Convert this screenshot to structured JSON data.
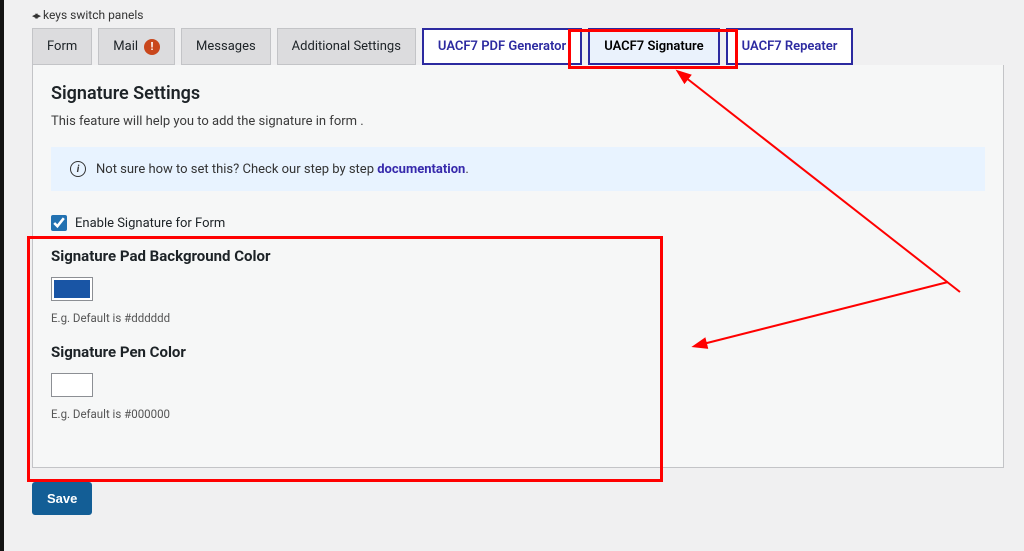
{
  "panelHint": {
    "text": "keys switch panels"
  },
  "tabs": [
    {
      "label": "Form",
      "name": "tab-form"
    },
    {
      "label": "Mail",
      "name": "tab-mail",
      "warn": true
    },
    {
      "label": "Messages",
      "name": "tab-messages"
    },
    {
      "label": "Additional Settings",
      "name": "tab-additional-settings"
    },
    {
      "label": "UACF7 PDF Generator",
      "name": "tab-uacf7-pdf-generator",
      "special": true
    },
    {
      "label": "UACF7 Signature",
      "name": "tab-uacf7-signature",
      "special": true,
      "active": true
    },
    {
      "label": "UACF7 Repeater",
      "name": "tab-uacf7-repeater",
      "special": true
    }
  ],
  "panel": {
    "title": "Signature Settings",
    "description": "This feature will help you to add the signature in form ."
  },
  "notice": {
    "prefix": "Not sure how to set this? Check our step by step ",
    "linkText": "documentation",
    "suffix": "."
  },
  "enable": {
    "label": "Enable Signature for Form",
    "checked": true
  },
  "bgColor": {
    "title": "Signature Pad Background Color",
    "value": "#1955a5",
    "hint": "E.g. Default is #dddddd"
  },
  "penColor": {
    "title": "Signature Pen Color",
    "value": "#ffffff",
    "hint": "E.g. Default is #000000"
  },
  "save": {
    "label": "Save"
  }
}
